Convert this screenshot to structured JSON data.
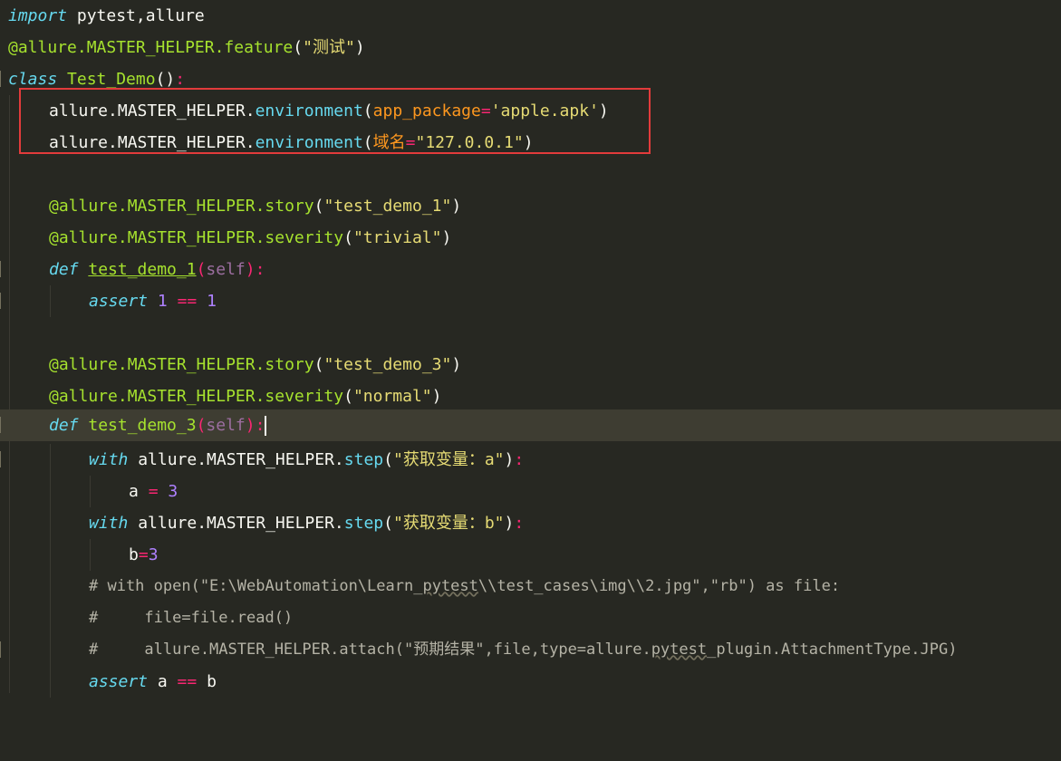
{
  "editor": {
    "colors": {
      "background": "#272822",
      "current_line": "#3e3d32",
      "highlight_box": "#e23b3b"
    },
    "lines": {
      "l1": {
        "kw": "import",
        "rest": " pytest,allure"
      },
      "l2": {
        "deco": "@allure.MASTER_HELPER.feature",
        "open": "(",
        "arg": "\"测试\"",
        "close": ")"
      },
      "l3": {
        "kw": "class",
        "name": " Test_Demo",
        "paren": "()",
        "colon": ":"
      },
      "l4": {
        "obj": "allure.MASTER_HELPER.",
        "fn": "environment",
        "open": "(",
        "param": "app_package",
        "eq": "=",
        "arg": "'apple.apk'",
        "close": ")"
      },
      "l5": {
        "obj": "allure.MASTER_HELPER.",
        "fn": "environment",
        "open": "(",
        "param": "域名",
        "eq": "=",
        "arg": "\"127.0.0.1\"",
        "close": ")"
      },
      "l7": {
        "deco": "@allure.MASTER_HELPER.story",
        "open": "(",
        "arg": "\"test_demo_1\"",
        "close": ")"
      },
      "l8": {
        "deco": "@allure.MASTER_HELPER.severity",
        "open": "(",
        "arg": "\"trivial\"",
        "close": ")"
      },
      "l9": {
        "kw": "def",
        "name": "test_demo_1",
        "open": "(",
        "self": "self",
        "close": ")",
        "colon": ":"
      },
      "l10": {
        "kw": "assert",
        "n1": "1",
        "op": "==",
        "n2": "1"
      },
      "l12": {
        "deco": "@allure.MASTER_HELPER.story",
        "open": "(",
        "arg": "\"test_demo_3\"",
        "close": ")"
      },
      "l13": {
        "deco": "@allure.MASTER_HELPER.severity",
        "open": "(",
        "arg": "\"normal\"",
        "close": ")"
      },
      "l14": {
        "kw": "def",
        "name": "test_demo_3",
        "open": "(",
        "self": "self",
        "close": ")",
        "colon": ":"
      },
      "l15": {
        "kw": "with",
        "obj": " allure.MASTER_HELPER.",
        "fn": "step",
        "open": "(",
        "arg": "\"获取变量：a\"",
        "close": ")",
        "colon": ":"
      },
      "l16": {
        "var": "a ",
        "op": "=",
        "num": " 3"
      },
      "l17": {
        "kw": "with",
        "obj": " allure.MASTER_HELPER.",
        "fn": "step",
        "open": "(",
        "arg": "\"获取变量：b\"",
        "close": ")",
        "colon": ":"
      },
      "l18": {
        "var": "b",
        "op": "=",
        "num": "3"
      },
      "l19": {
        "c1": "# with open(\"E:\\WebAutomation\\Learn_",
        "c2": "pytest",
        "c3": "\\\\test_cases\\img\\\\2.jpg\",\"rb\") as file:"
      },
      "l20": {
        "c1": "#     file=file.read()"
      },
      "l21": {
        "c1": "#     allure.MASTER_HELPER.attach(\"预期结果\",file,type=allure.",
        "c2": "pytest",
        "c3": "_plugin.AttachmentType.JPG)"
      },
      "l22": {
        "kw": "assert",
        "a": " a ",
        "op": "==",
        "b": " b"
      }
    }
  }
}
